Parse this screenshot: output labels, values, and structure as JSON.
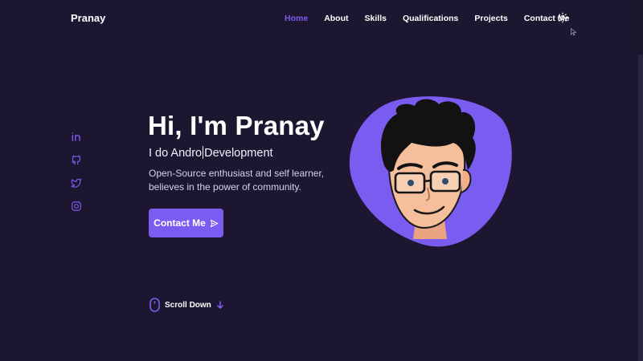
{
  "nav": {
    "logo": "Pranay",
    "links": [
      "Home",
      "About",
      "Skills",
      "Qualifications",
      "Projects",
      "Contact Me"
    ],
    "active": "Home",
    "theme_icon": "sun-icon"
  },
  "social": [
    "linkedin-icon",
    "github-icon",
    "twitter-icon",
    "instagram-icon"
  ],
  "hero": {
    "title": "Hi, I'm Pranay",
    "subtitle_typed": "I do Andro",
    "subtitle_rest": "Development",
    "description": "Open-Source enthusiast and self learner, believes in the power of community.",
    "cta_label": "Contact Me"
  },
  "scroll": {
    "label": "Scroll Down"
  },
  "colors": {
    "background": "#1c1630",
    "accent": "#7b5cf0",
    "text": "#ffffff"
  }
}
